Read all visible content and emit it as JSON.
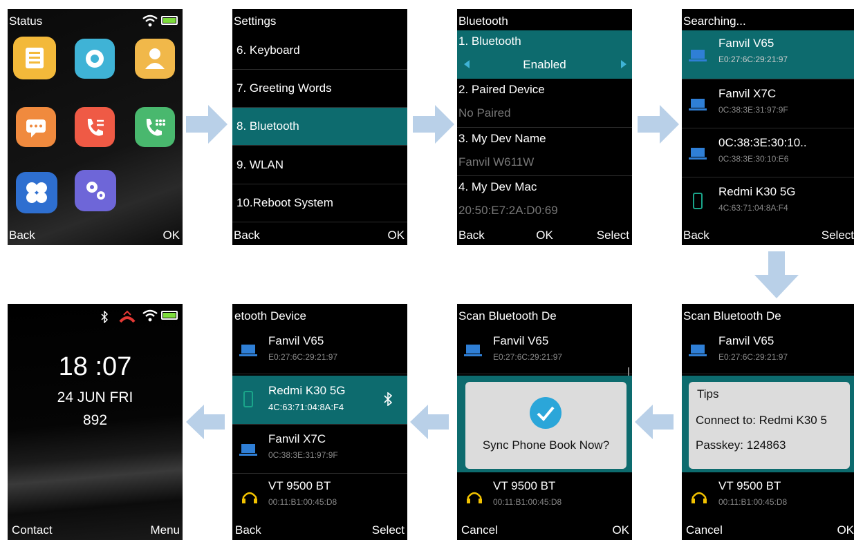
{
  "screen1": {
    "title": "Status",
    "soft_left": "Back",
    "soft_right": "OK",
    "apps": [
      "contacts-app-icon",
      "settings-app-icon",
      "profile-app-icon",
      "messages-app-icon",
      "call-history-app-icon",
      "dialer-app-icon",
      "apps-app-icon",
      "advanced-settings-app-icon"
    ]
  },
  "screen2": {
    "title": "Settings",
    "items": [
      "6. Keyboard",
      "7. Greeting Words",
      "8. Bluetooth",
      "9. WLAN",
      "10.Reboot System"
    ],
    "soft_left": "Back",
    "soft_right": "OK"
  },
  "screen3": {
    "title": "Bluetooth",
    "bt_label": "1. Bluetooth",
    "bt_value": "Enabled",
    "paired_label": "2. Paired Device",
    "paired_value": "No Paired",
    "devname_label": "3. My Dev Name",
    "devname_value": "Fanvil W611W",
    "mac_label": "4. My Dev Mac",
    "mac_value": "20:50:E7:2A:D0:69",
    "soft_left": "Back",
    "soft_center": "OK",
    "soft_right": "Select"
  },
  "screen4": {
    "title": "Searching...",
    "devices": [
      {
        "name": "Fanvil V65",
        "mac": "E0:27:6C:29:21:97"
      },
      {
        "name": "Fanvil X7C",
        "mac": "0C:38:3E:31:97:9F"
      },
      {
        "name": "0C:38:3E:30:10..",
        "mac": "0C:38:3E:30:10:E6"
      },
      {
        "name": "Redmi K30 5G",
        "mac": "4C:63:71:04:8A:F4"
      }
    ],
    "soft_left": "Back",
    "soft_right": "Select"
  },
  "screen5": {
    "title": "Scan Bluetooth De",
    "dev_top": {
      "name": "Fanvil V65",
      "mac": "E0:27:6C:29:21:97"
    },
    "dev_bottom": {
      "name": "VT 9500 BT",
      "mac": "00:11:B1:00:45:D8"
    },
    "tips_title": "Tips",
    "tips_connect": "Connect to: Redmi K30 5",
    "tips_passkey": "Passkey: 124863",
    "soft_left": "Cancel",
    "soft_right": "OK"
  },
  "screen6": {
    "title": "Scan Bluetooth De",
    "dev_top": {
      "name": "Fanvil V65",
      "mac": "E0:27:6C:29:21:97"
    },
    "dev_bottom": {
      "name": "VT 9500 BT",
      "mac": "00:11:B1:00:45:D8"
    },
    "dialog_text": "Sync Phone Book Now?",
    "soft_left": "Cancel",
    "soft_right": "OK"
  },
  "screen7": {
    "title": "etooth Device",
    "devices": [
      {
        "name": "Fanvil V65",
        "mac": "E0:27:6C:29:21:97"
      },
      {
        "name": "Redmi K30 5G",
        "mac": "4C:63:71:04:8A:F4"
      },
      {
        "name": "Fanvil X7C",
        "mac": "0C:38:3E:31:97:9F"
      },
      {
        "name": "VT 9500 BT",
        "mac": "00:11:B1:00:45:D8"
      }
    ],
    "soft_left": "Back",
    "soft_right": "Select"
  },
  "screen8": {
    "time": "18 :07",
    "date": "24 JUN FRI",
    "extension": "892",
    "soft_left": "Contact",
    "soft_right": "Menu"
  },
  "colors": {
    "highlight": "#0d6b6e",
    "arrow": "#b9d0e8",
    "laptop": "#2f7fd6",
    "phone": "#1aa58a"
  }
}
